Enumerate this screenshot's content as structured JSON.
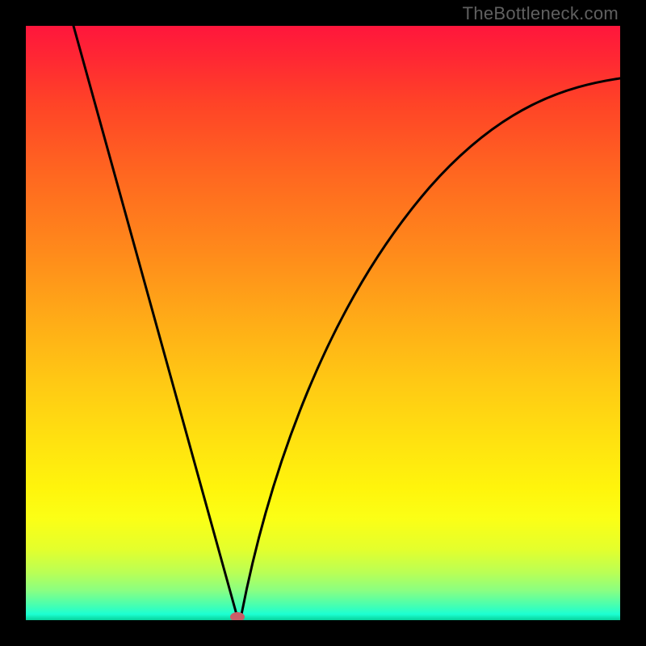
{
  "watermark": "TheBottleneck.com",
  "chart_data": {
    "type": "line",
    "title": "",
    "xlabel": "",
    "ylabel": "",
    "xlim": [
      0,
      1
    ],
    "ylim": [
      0,
      1
    ],
    "series": [
      {
        "name": "curve",
        "x": [
          0.08,
          0.13,
          0.18,
          0.23,
          0.28,
          0.31,
          0.33,
          0.34,
          0.35,
          0.355,
          0.36,
          0.37,
          0.38,
          0.4,
          0.43,
          0.47,
          0.52,
          0.58,
          0.65,
          0.72,
          0.8,
          0.88,
          0.96,
          1.0
        ],
        "y": [
          1.0,
          0.82,
          0.64,
          0.46,
          0.28,
          0.17,
          0.095,
          0.06,
          0.025,
          0.01,
          0.02,
          0.075,
          0.13,
          0.22,
          0.33,
          0.45,
          0.56,
          0.66,
          0.74,
          0.8,
          0.85,
          0.88,
          0.902,
          0.912
        ]
      }
    ],
    "marker": {
      "x": 0.355,
      "y": 0.005,
      "color": "#c95d67"
    },
    "gradient_stops": [
      {
        "pos": 0.0,
        "color": "#ff163c"
      },
      {
        "pos": 0.5,
        "color": "#ffad17"
      },
      {
        "pos": 0.78,
        "color": "#fff50c"
      },
      {
        "pos": 0.95,
        "color": "#8aff82"
      },
      {
        "pos": 1.0,
        "color": "#06d19a"
      }
    ]
  }
}
